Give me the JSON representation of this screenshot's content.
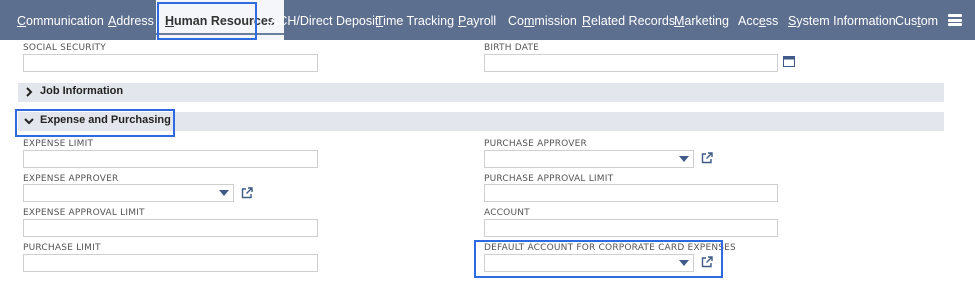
{
  "tabs": [
    {
      "pre": "",
      "ul": "C",
      "post": "ommunication"
    },
    {
      "pre": "",
      "ul": "A",
      "post": "ddress"
    },
    {
      "pre": "",
      "ul": "H",
      "post": "uman Resources"
    },
    {
      "pre": "ACH/Direct Deposit",
      "ul": "",
      "post": ""
    },
    {
      "pre": "",
      "ul": "T",
      "post": "ime Tracking"
    },
    {
      "pre": "",
      "ul": "P",
      "post": "ayroll"
    },
    {
      "pre": "Co",
      "ul": "m",
      "post": "mission"
    },
    {
      "pre": "",
      "ul": "R",
      "post": "elated Records"
    },
    {
      "pre": "",
      "ul": "M",
      "post": "arketing"
    },
    {
      "pre": "Acc",
      "ul": "e",
      "post": "ss"
    },
    {
      "pre": "",
      "ul": "S",
      "post": "ystem Information"
    },
    {
      "pre": "Cus",
      "ul": "t",
      "post": "om"
    }
  ],
  "active_tab_index": 2,
  "fields": {
    "social_security": {
      "label": "SOCIAL SECURITY",
      "value": ""
    },
    "birth_date": {
      "label": "BIRTH DATE",
      "value": ""
    },
    "expense_limit": {
      "label": "EXPENSE LIMIT",
      "value": ""
    },
    "purchase_approver": {
      "label": "PURCHASE APPROVER",
      "value": ""
    },
    "expense_approver": {
      "label": "EXPENSE APPROVER",
      "value": ""
    },
    "purchase_approval_limit": {
      "label": "PURCHASE APPROVAL LIMIT",
      "value": ""
    },
    "expense_approval_limit": {
      "label": "EXPENSE APPROVAL LIMIT",
      "value": ""
    },
    "account": {
      "label": "ACCOUNT",
      "value": ""
    },
    "purchase_limit": {
      "label": "PURCHASE LIMIT",
      "value": ""
    },
    "default_account_corporate_card": {
      "label": "DEFAULT ACCOUNT FOR CORPORATE CARD EXPENSES",
      "value": ""
    }
  },
  "sections": {
    "job_information": {
      "title": "Job Information",
      "icon": "chevron-right-icon"
    },
    "expense_and_purchasing": {
      "title": "Expense and Purchasing",
      "icon": "chevron-down-icon"
    }
  },
  "colors": {
    "tab_bar": "#5d6f8f",
    "highlight": "#2f6be0",
    "section_band": "#e3e6ec",
    "accent_icon": "#3f5a86"
  }
}
